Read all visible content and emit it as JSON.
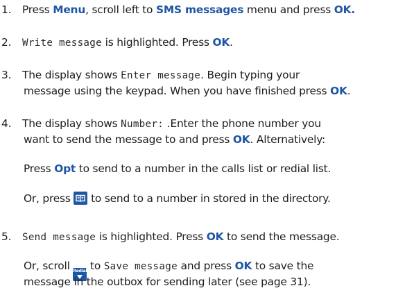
{
  "steps": {
    "s1": {
      "num": "1.",
      "t1": "Press ",
      "k1": "Menu",
      "t2": ", scroll left to ",
      "k2": "SMS messages",
      "t3": " menu and press ",
      "k3": "OK."
    },
    "s2": {
      "num": "2.",
      "d1": "Write message",
      "t1": " is highlighted. Press ",
      "k1": "OK",
      "t2": "."
    },
    "s3": {
      "num": "3.",
      "t1": "The display shows ",
      "d1": "Enter message",
      "t2": ". Begin typing your",
      "t3": "message using the keypad. When you have finished press ",
      "k1": "OK",
      "t4": "."
    },
    "s4": {
      "num": "4.",
      "t1": "The display shows ",
      "d1": "Number:",
      "t2": " .Enter the phone number you",
      "t3": "want to send the message to and press ",
      "k1": "OK",
      "t4": ". Alternatively:",
      "p1a": "Press ",
      "p1k": "Opt",
      "p1b": " to send to a number in the calls list or redial list.",
      "p2a": "Or, press ",
      "p2b": " to send to a number in stored in the directory."
    },
    "s5": {
      "num": "5.",
      "d1": "Send message",
      "t1": " is highlighted. Press ",
      "k1": "OK",
      "t2": " to send the message.",
      "p1a": "Or, scroll ",
      "p1d": "Save message",
      "p1b": " and press ",
      "p1k": "OK",
      "p1c": " to save the",
      "p2": "message in the outbox for sending later (see page 31)."
    }
  },
  "icons": {
    "directory": "book-icon",
    "redial": "redial-down-icon",
    "redial_label": "Redial"
  },
  "colors": {
    "keyword": "#1f56a3",
    "text": "#1c1c1c",
    "icon_bg": "#1f56a3"
  }
}
